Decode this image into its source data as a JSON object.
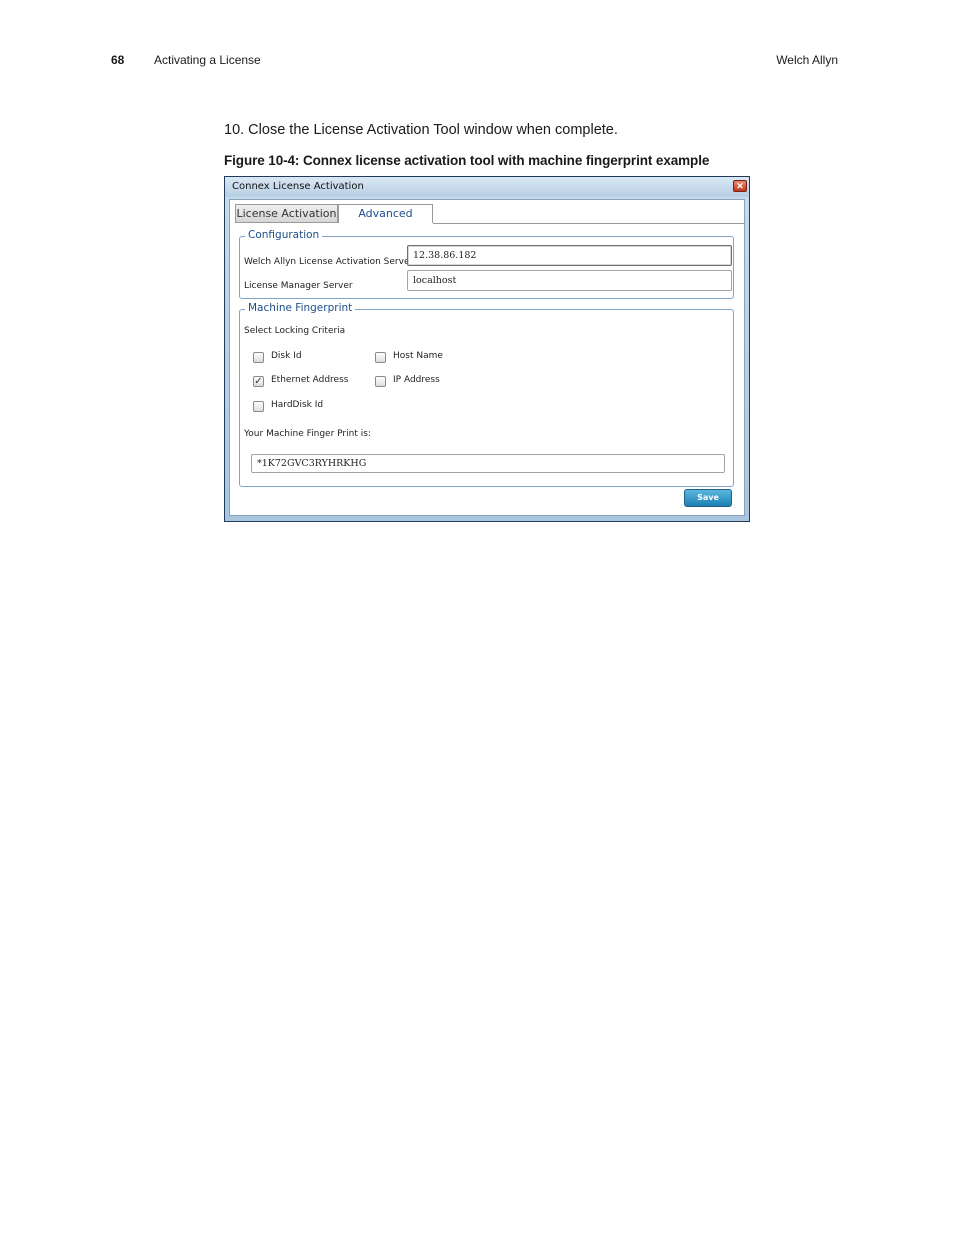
{
  "header": {
    "page_number": "68",
    "section": "Activating a License",
    "brand": "Welch Allyn"
  },
  "step_text": "10.  Close the License Activation Tool window when complete.",
  "figure_caption": "Figure 10-4: Connex license activation tool with machine fingerprint example",
  "dialog": {
    "title": "Connex License Activation",
    "close_glyph": "✕",
    "tabs": {
      "license_activation": "License Activation",
      "advanced": "Advanced"
    },
    "configuration": {
      "legend": "Configuration",
      "activation_server_label": "Welch Allyn License Activation Server",
      "activation_server_value": "12.38.86.182",
      "manager_server_label": "License Manager Server",
      "manager_server_value": "localhost"
    },
    "fingerprint": {
      "legend": "Machine Fingerprint",
      "criteria_label": "Select Locking Criteria",
      "options": {
        "disk_id": {
          "label": "Disk Id",
          "checked": false
        },
        "host_name": {
          "label": "Host Name",
          "checked": false
        },
        "ethernet_address": {
          "label": "Ethernet Address",
          "checked": true
        },
        "ip_address": {
          "label": "IP Address",
          "checked": false
        },
        "harddisk_id": {
          "label": "HardDisk Id",
          "checked": false
        }
      },
      "result_label": "Your Machine Finger Print is:",
      "result_value": "*1K72GVC3RYHRKHG"
    },
    "save_label": "Save",
    "check_glyph": "✓"
  }
}
